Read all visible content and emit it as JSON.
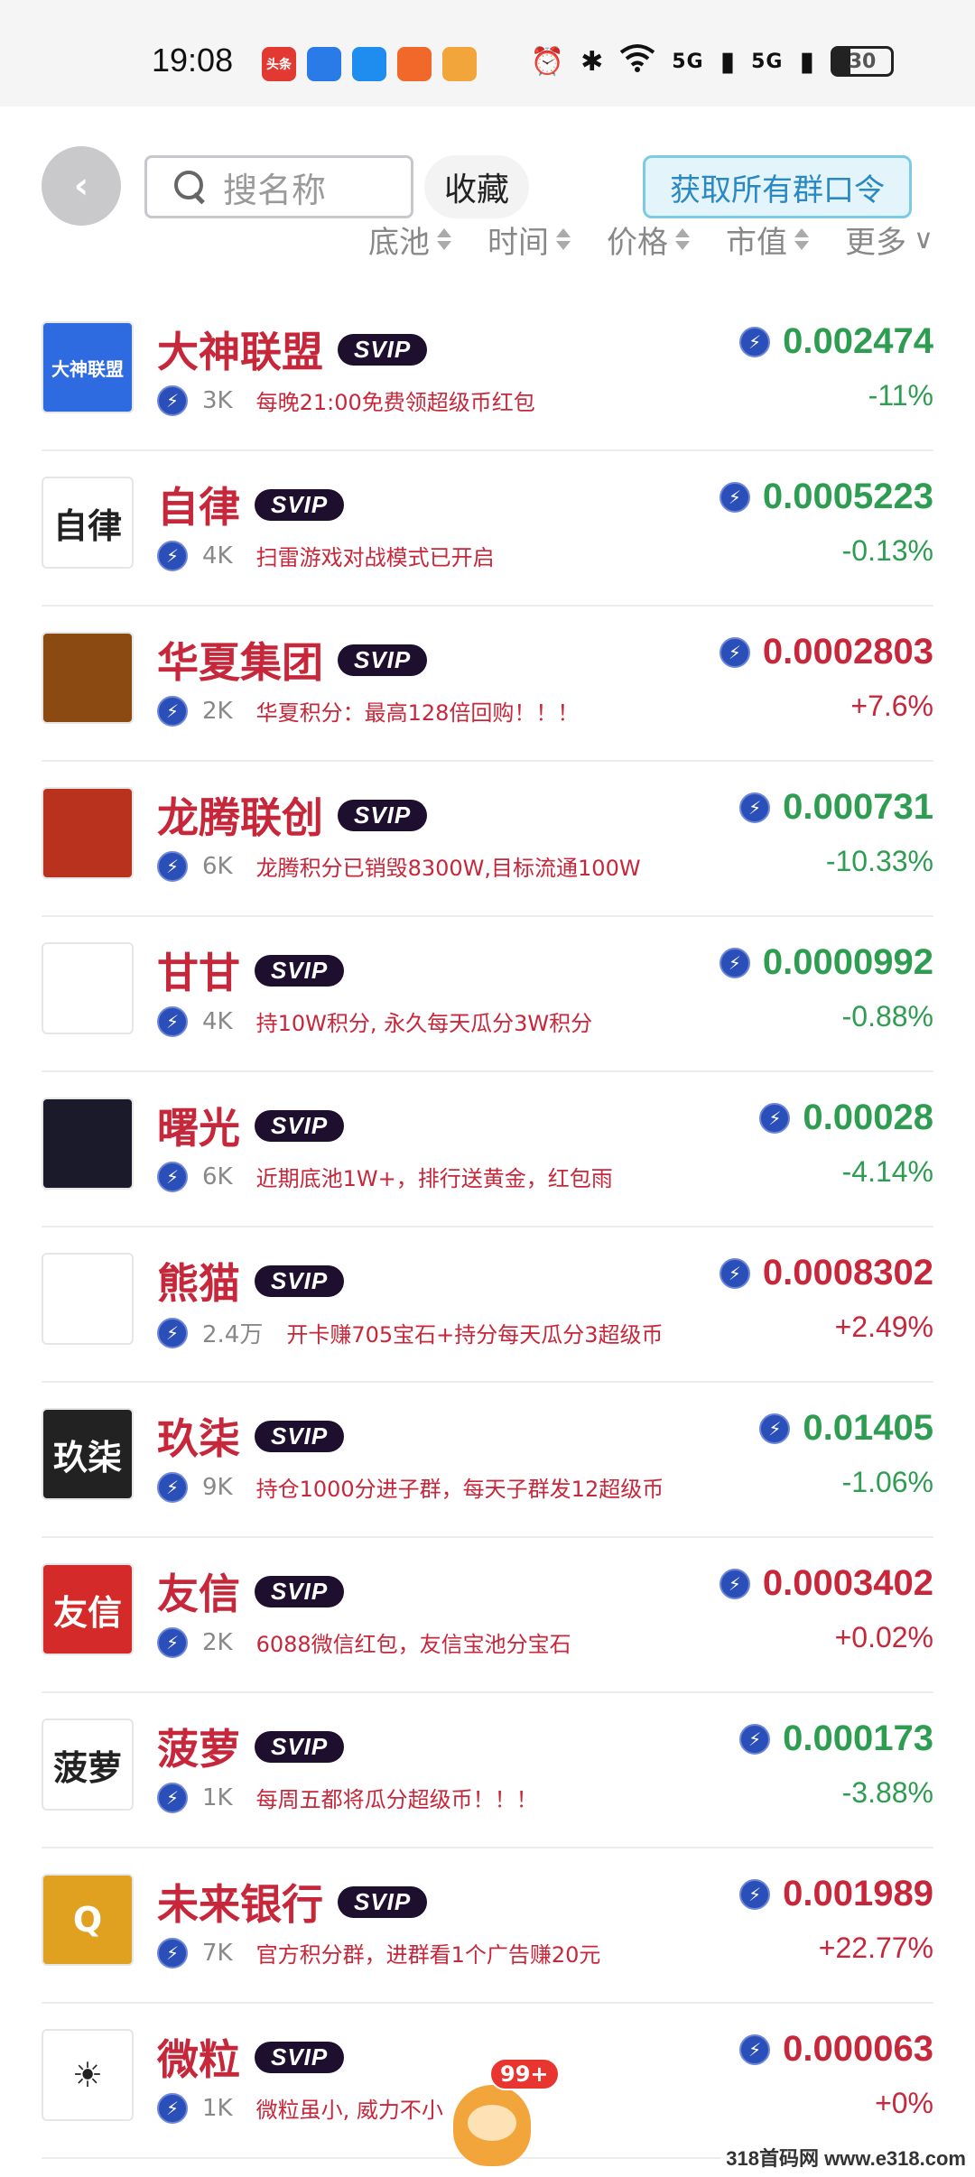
{
  "status_bar": {
    "time": "19:08",
    "battery": "30",
    "signal_1": "5G",
    "signal_2": "5G",
    "apps": [
      {
        "icon": "toutiao-icon",
        "label": "头条",
        "color": "#e23a32"
      },
      {
        "icon": "tiktok-lite-icon",
        "label": "",
        "color": "#2a7be8"
      },
      {
        "icon": "phone-app-icon",
        "label": "",
        "color": "#1f8cf0"
      },
      {
        "icon": "orange-app-icon",
        "label": "",
        "color": "#f0692a"
      },
      {
        "icon": "game-app-icon",
        "label": "",
        "color": "#f2a53a"
      }
    ]
  },
  "header": {
    "search_placeholder": "搜名称",
    "favorites_label": "收藏",
    "get_commands_label": "获取所有群口令"
  },
  "sort_bar": {
    "pool": "底池",
    "time": "时间",
    "price": "价格",
    "market_cap": "市值",
    "more": "更多"
  },
  "groups": [
    {
      "name": "大神联盟",
      "badge": "SVIP",
      "members": "3K",
      "desc": "每晚21:00免费领超级币红包",
      "price": "0.002474",
      "change": "-11%",
      "trend": "down",
      "logo_text": "大神联盟",
      "logo_bg": "#2f6be0"
    },
    {
      "name": "自律",
      "badge": "SVIP",
      "members": "4K",
      "desc": "扫雷游戏对战模式已开启",
      "price": "0.0005223",
      "change": "-0.13%",
      "trend": "down",
      "logo_text": "自律",
      "logo_bg": "#ffffff"
    },
    {
      "name": "华夏集团",
      "badge": "SVIP",
      "members": "2K",
      "desc": "华夏积分：最高128倍回购！！！",
      "price": "0.0002803",
      "change": "+7.6%",
      "trend": "up",
      "logo_text": "",
      "logo_bg": "#8a4a12"
    },
    {
      "name": "龙腾联创",
      "badge": "SVIP",
      "members": "6K",
      "desc": "龙腾积分已销毁8300W,目标流通100W",
      "price": "0.000731",
      "change": "-10.33%",
      "trend": "down",
      "logo_text": "",
      "logo_bg": "#b8321e"
    },
    {
      "name": "甘甘",
      "badge": "SVIP",
      "members": "4K",
      "desc": "持10W积分, 永久每天瓜分3W积分",
      "price": "0.0000992",
      "change": "-0.88%",
      "trend": "down",
      "logo_text": "",
      "logo_bg": "#ffffff"
    },
    {
      "name": "曙光",
      "badge": "SVIP",
      "members": "6K",
      "desc": "近期底池1W+，排行送黄金，红包雨",
      "price": "0.00028",
      "change": "-4.14%",
      "trend": "down",
      "logo_text": "",
      "logo_bg": "#1a1a2a"
    },
    {
      "name": "熊猫",
      "badge": "SVIP",
      "members": "2.4万",
      "desc": "开卡赚705宝石+持分每天瓜分3超级币",
      "price": "0.0008302",
      "change": "+2.49%",
      "trend": "up",
      "logo_text": "",
      "logo_bg": "#ffffff"
    },
    {
      "name": "玖柒",
      "badge": "SVIP",
      "members": "9K",
      "desc": "持仓1000分进子群，每天子群发12超级币",
      "price": "0.01405",
      "change": "-1.06%",
      "trend": "down",
      "logo_text": "玖柒",
      "logo_bg": "#222222"
    },
    {
      "name": "友信",
      "badge": "SVIP",
      "members": "2K",
      "desc": "6088微信红包，友信宝池分宝石",
      "price": "0.0003402",
      "change": "+0.02%",
      "trend": "up",
      "logo_text": "友信",
      "logo_bg": "#d42a2a"
    },
    {
      "name": "菠萝",
      "badge": "SVIP",
      "members": "1K",
      "desc": "每周五都将瓜分超级币！！！",
      "price": "0.000173",
      "change": "-3.88%",
      "trend": "down",
      "logo_text": "菠萝",
      "logo_bg": "#ffffff"
    },
    {
      "name": "未来银行",
      "badge": "SVIP",
      "members": "7K",
      "desc": "官方积分群，进群看1个广告赚20元",
      "price": "0.001989",
      "change": "+22.77%",
      "trend": "up",
      "logo_text": "Q",
      "logo_bg": "#e0a020"
    },
    {
      "name": "微粒",
      "badge": "SVIP",
      "members": "1K",
      "desc": "微粒虽小, 威力不小",
      "price": "0.000063",
      "change": "+0%",
      "trend": "up",
      "logo_text": "☀",
      "logo_bg": "#ffffff"
    }
  ],
  "floating": {
    "badge": "99+"
  },
  "watermark": "318首码网 www.e318.com",
  "colors": {
    "up": "#c7273a",
    "down": "#2e9d52",
    "name": "#c7273a",
    "svip_bg": "#1f0f2e",
    "accent": "#2a88c2"
  }
}
